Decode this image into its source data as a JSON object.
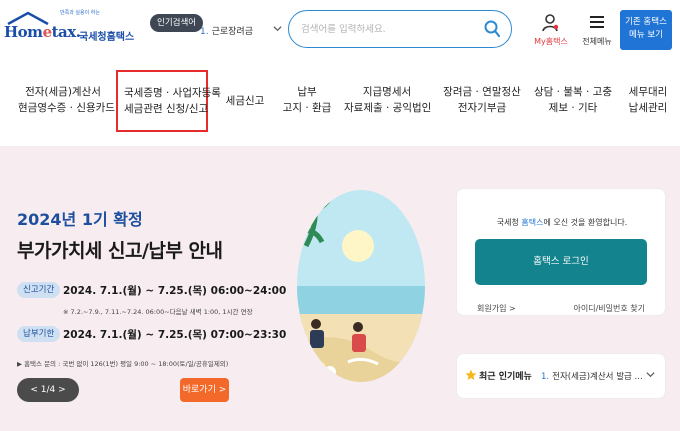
{
  "header": {
    "logo_slogan": "만족과 실용이 하는",
    "logo_en_prefix": "Hom",
    "logo_en_e": "e",
    "logo_en_suffix": "tax.",
    "logo_kr": "국세청홈택스",
    "popular_label": "인기검색어",
    "popular_num": "1.",
    "popular_value": "근로장려금",
    "search_placeholder": "검색어를 입력하세요.",
    "my_hometax": "My홈택스",
    "all_menu": "전체메뉴",
    "legacy_line1": "기존 홈택스",
    "legacy_line2": "메뉴 보기"
  },
  "gnb": [
    {
      "line1": "전자(세금)계산서",
      "line2": "현금영수증 · 신용카드"
    },
    {
      "line1": "국세증명 · 사업자등록",
      "line2": "세금관련 신청/신고"
    },
    {
      "line1": "세금신고",
      "line2": ""
    },
    {
      "line1": "납부",
      "line2": "고지 · 환급"
    },
    {
      "line1": "지급명세서",
      "line2": "자료제출 · 공익법인"
    },
    {
      "line1": "장려금 · 연말정산",
      "line2": "전자기부금"
    },
    {
      "line1": "상담 · 불복 · 고충",
      "line2": "제보 · 기타"
    },
    {
      "line1": "세무대리",
      "line2": "납세관리"
    }
  ],
  "banner": {
    "year_title": "2024년 1기 확정",
    "main_title": "부가가치세 신고/납부 안내",
    "report_tag": "신고기간",
    "report_period": "2024. 7.1.(월) ~ 7.25.(목) 06:00~24:00",
    "report_note": "※ 7.2.~7.9., 7.11.~7.24. 06:00~다음날 새벽 1:00, 1시간 연장",
    "pay_tag": "납부기한",
    "pay_period": "2024. 7.1.(월) ~ 7.25.(목) 07:00~23:30",
    "inquiry": "▶ 홈택스 문의 : 국번 없이 126(1번) 평일 9:00 ~ 18:00(토/일/공휴일제외)",
    "pager": "< 1/4 >",
    "shortcut": "바로가기 >"
  },
  "login": {
    "welcome_prefix": "국세청 ",
    "welcome_brand": "홈택스",
    "welcome_suffix": "에 오신 것을 환영합니다.",
    "login_button": "홈택스 로그인",
    "signup": "회원가입 >",
    "find_id": "아이디/비밀번호 찾기"
  },
  "popular_menu": {
    "label": "최근 인기메뉴",
    "num": "1.",
    "item": "전자(세금)계산서 발급 ..."
  },
  "colors": {
    "brand_blue": "#1f74d6",
    "login_teal": "#13838e",
    "shortcut_orange": "#f2692a",
    "highlight_red": "#e52b2b",
    "banner_bg": "#f7ecef"
  }
}
